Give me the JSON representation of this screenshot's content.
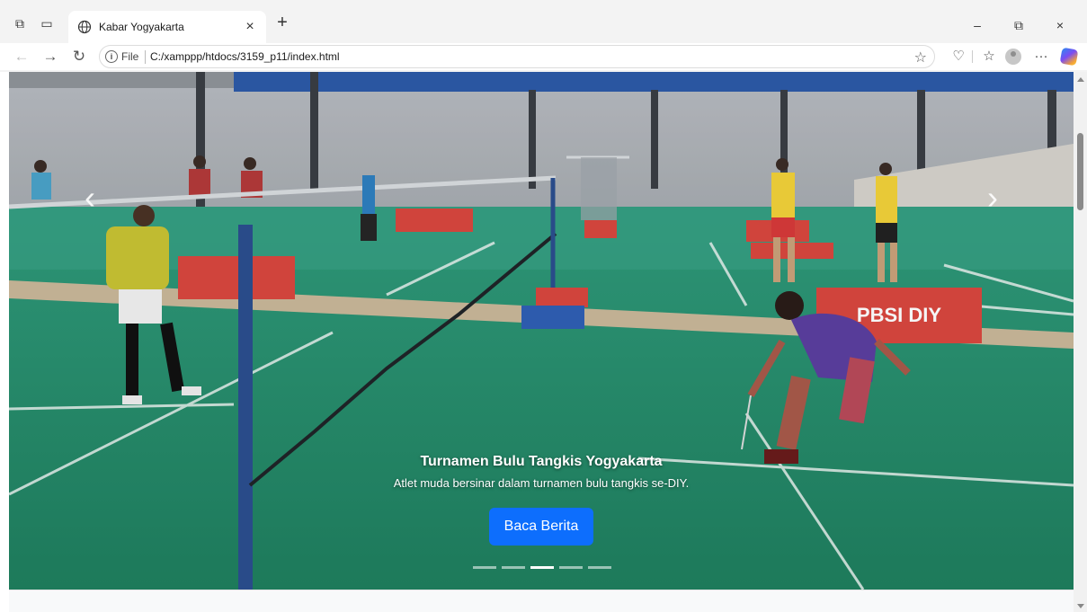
{
  "browser": {
    "tab_title": "Kabar Yogyakarta",
    "address": {
      "scheme_label": "File",
      "url": "C:/xamppp/htdocs/3159_p11/index.html"
    }
  },
  "carousel": {
    "slide": {
      "title": "Turnamen Bulu Tangkis Yogyakarta",
      "text": "Atlet muda bersinar dalam turnamen bulu tangkis se-DIY.",
      "button_label": "Baca Berita"
    },
    "banner_text": "PBSI DIY",
    "indicators_count": 5,
    "active_indicator": 3
  },
  "icons": {
    "prev": "chevron-left-icon",
    "next": "chevron-right-icon"
  },
  "colors": {
    "primary_button": "#0d6efd",
    "court_green": "#1f8f6a"
  }
}
